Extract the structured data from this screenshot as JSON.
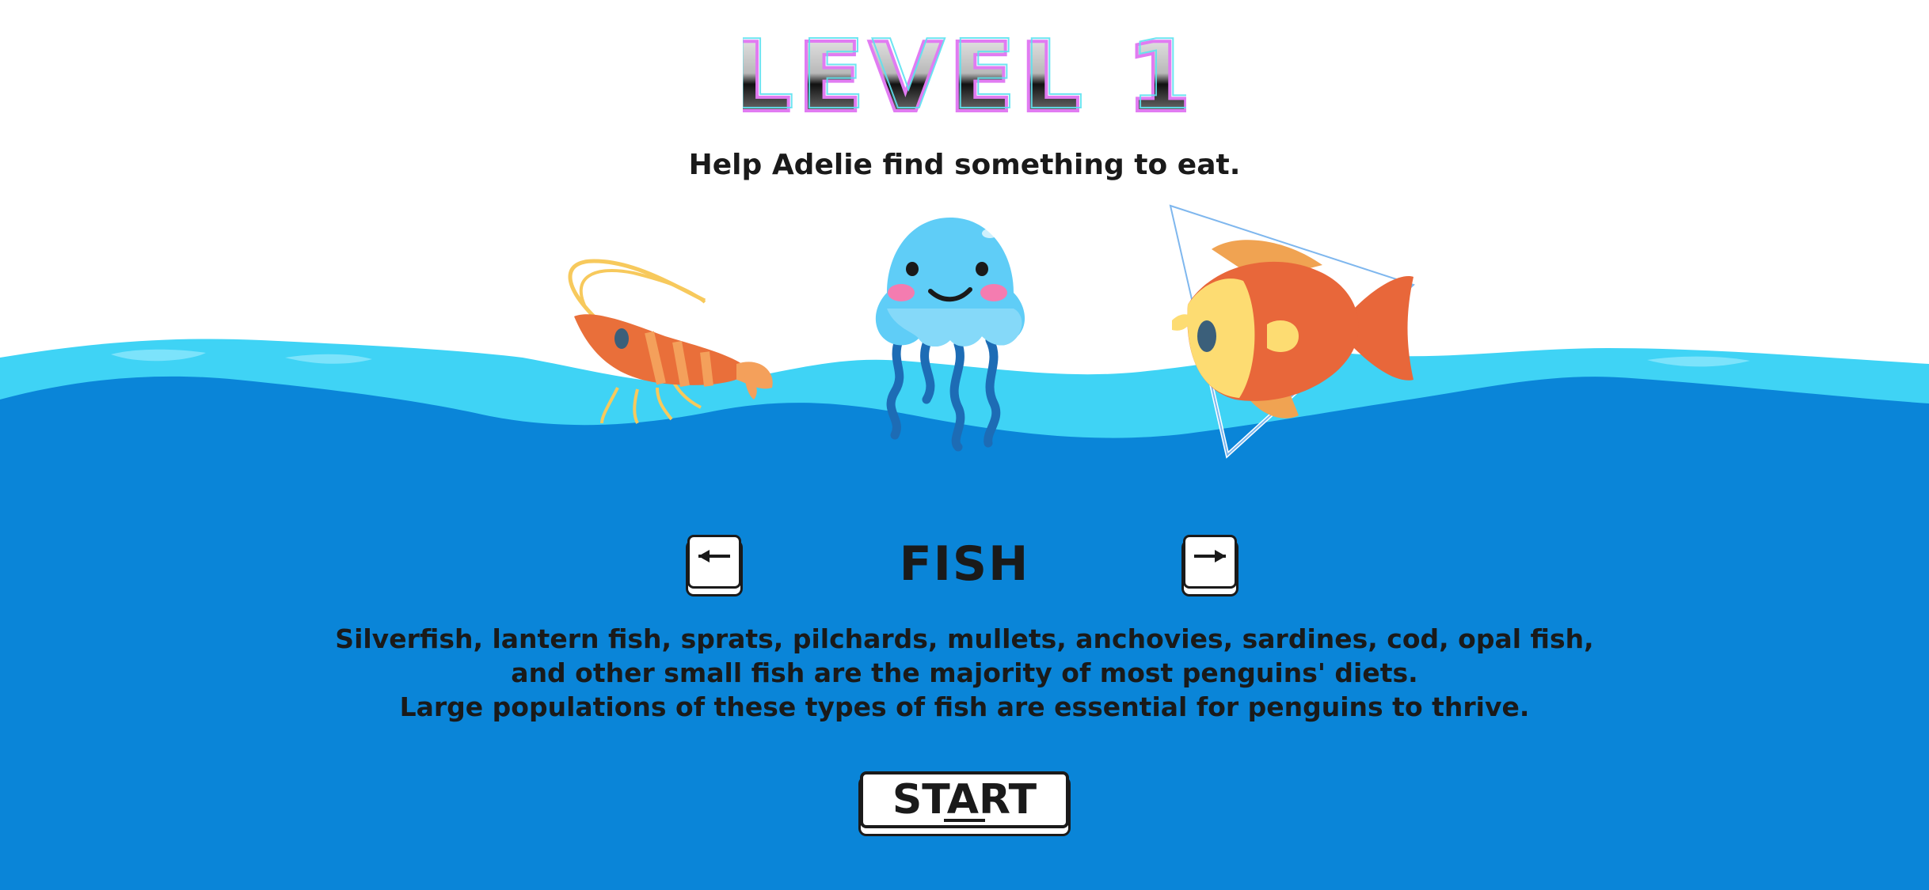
{
  "level": {
    "title": "LEVEL 1",
    "subtitle": "Help Adelie find something to eat."
  },
  "creatures": [
    {
      "name": "shrimp",
      "icon": "shrimp-icon"
    },
    {
      "name": "jellyfish",
      "icon": "jellyfish-icon"
    },
    {
      "name": "fish",
      "icon": "fish-icon",
      "selected": true
    }
  ],
  "selector": {
    "prev_icon": "arrow-left-icon",
    "next_icon": "arrow-right-icon",
    "current_label": "FISH"
  },
  "description": {
    "lines": [
      "Silverfish, lantern fish, sprats, pilchards, mullets, anchovies, sardines, cod, opal fish,",
      "and other small fish are the majority of most penguins' diets.",
      "Large populations of these types of fish are essential for penguins to thrive."
    ]
  },
  "start_button": {
    "label": "START"
  },
  "colors": {
    "sea": "#0a85d8",
    "wave_light": "#3fd3f5",
    "text": "#1a1a1a",
    "jelly": "#5fcdf7",
    "fish_body": "#e8673a",
    "fish_face": "#fddc72",
    "shrimp": "#e96f3a"
  }
}
